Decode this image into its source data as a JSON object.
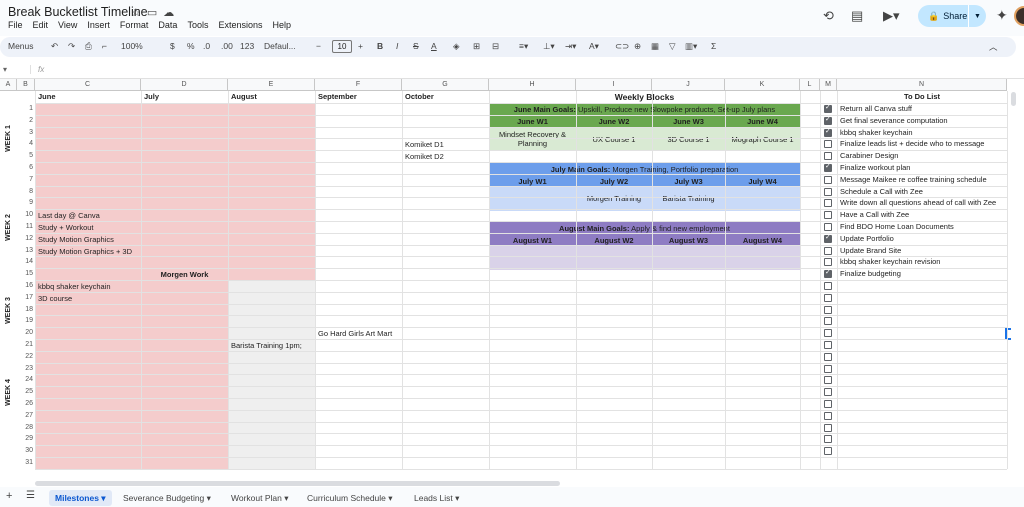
{
  "doc": {
    "title": "Break Bucketlist Timeline"
  },
  "menu": [
    "File",
    "Edit",
    "View",
    "Insert",
    "Format",
    "Data",
    "Tools",
    "Extensions",
    "Help"
  ],
  "share_label": "Share",
  "toolbar": {
    "menus": "Menus",
    "zoom": "100%",
    "currency": "$",
    "percent": "%",
    "dec_less": ".0",
    "dec_more": ".00",
    "num_format": "123",
    "font": "Defaul...",
    "font_size": "10"
  },
  "formula": {
    "namebox": "",
    "fx": "fx"
  },
  "columns": [
    "A",
    "B",
    "C",
    "D",
    "E",
    "F",
    "G",
    "H",
    "I",
    "J",
    "K",
    "L",
    "M",
    "N"
  ],
  "headers": {
    "june": "June",
    "july": "July",
    "august": "August",
    "september": "September",
    "october": "October",
    "weekly_blocks": "Weekly Blocks",
    "todo": "To Do List"
  },
  "weeks": [
    "WEEK 1",
    "WEEK 2",
    "WEEK 3",
    "WEEK 4"
  ],
  "month_cells": {
    "c10": "Last day @ Canva",
    "c11": "Study + Workout",
    "c12": "Study Motion Graphics",
    "c13": "Study Motion Graphics + 3D",
    "c16": "kbbq shaker keychain",
    "c17": "3D course",
    "d15": "Morgen Work",
    "e21": "Barista Training 1pm;",
    "f20": "Go Hard Girls Art Mart",
    "g4": "Komiket D1",
    "g5": "Komiket D2"
  },
  "june_block": {
    "goal_label": "June Main Goals:",
    "goal": "Upskill, Produce new Slowpoke products, Set-up July plans",
    "weeks": [
      "June W1",
      "June W2",
      "June W3",
      "June W4"
    ],
    "tasks": [
      "Mindset Recovery & Planning",
      "UX Course 1",
      "3D Course 1",
      "Mograph Course 1"
    ]
  },
  "july_block": {
    "goal_label": "July Main Goals:",
    "goal": "Morgen Training, Portfolio preparation",
    "weeks": [
      "July W1",
      "July W2",
      "July W3",
      "July W4"
    ],
    "tasks": [
      "",
      "Morgen Training",
      "Barista Training",
      ""
    ]
  },
  "aug_block": {
    "goal_label": "August Main Goals:",
    "goal": "Apply & find new employment",
    "weeks": [
      "August W1",
      "August W2",
      "August W3",
      "August W4"
    ]
  },
  "todo": [
    {
      "text": "Return all Canva stuff",
      "done": true
    },
    {
      "text": "Get final severance computation",
      "done": true
    },
    {
      "text": "kbbq shaker keychain",
      "done": true
    },
    {
      "text": "Finalize leads list + decide who to message",
      "done": false
    },
    {
      "text": "Carabiner Design",
      "done": false
    },
    {
      "text": "Finalize workout plan",
      "done": true
    },
    {
      "text": "Message Maikee re coffee training schedule",
      "done": false
    },
    {
      "text": "Schedule a Call with Zee",
      "done": false
    },
    {
      "text": "Write down all questions ahead of call with Zee",
      "done": false
    },
    {
      "text": "Have a Call with Zee",
      "done": false
    },
    {
      "text": "Find BDO Home Loan Documents",
      "done": false
    },
    {
      "text": "Update Portfolio",
      "done": true
    },
    {
      "text": "Update Brand Site",
      "done": false
    },
    {
      "text": "kbbq shaker keychain revision",
      "done": false
    },
    {
      "text": "Finalize budgeting",
      "done": true
    },
    {
      "text": "",
      "done": false
    },
    {
      "text": "",
      "done": false
    },
    {
      "text": "",
      "done": false
    },
    {
      "text": "",
      "done": false
    },
    {
      "text": "",
      "done": false
    },
    {
      "text": "",
      "done": false
    },
    {
      "text": "",
      "done": false
    },
    {
      "text": "",
      "done": false
    },
    {
      "text": "",
      "done": false
    },
    {
      "text": "",
      "done": false
    },
    {
      "text": "",
      "done": false
    },
    {
      "text": "",
      "done": false
    },
    {
      "text": "",
      "done": false
    },
    {
      "text": "",
      "done": false
    },
    {
      "text": "",
      "done": false
    }
  ],
  "sheet_tabs": [
    "Milestones",
    "Severance Budgeting",
    "Workout Plan",
    "Curriculum Schedule",
    "Leads List"
  ],
  "colors": {
    "pink": "#f4cccc",
    "grey": "#efefef",
    "green_dark": "#6aa84f",
    "green_light": "#d9ead3",
    "blue_dark": "#6d9eeb",
    "blue_light": "#c9daf8",
    "purple_dark": "#8e7cc3",
    "purple_light": "#d9d2e9"
  }
}
